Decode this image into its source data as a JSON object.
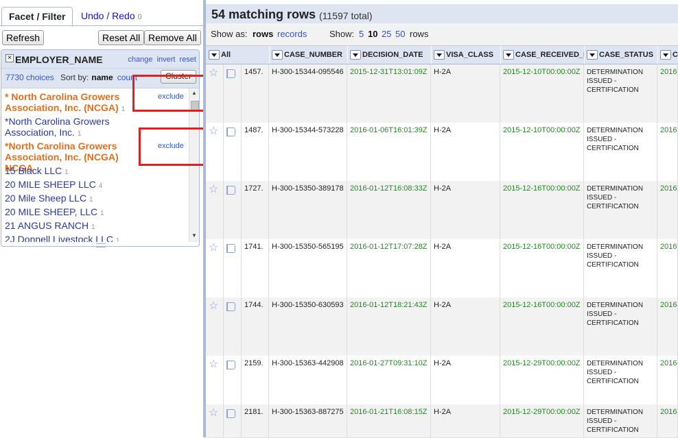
{
  "left": {
    "tabs": {
      "facet_filter": "Facet / Filter",
      "undo_redo": "Undo / Redo",
      "undo_count": "0"
    },
    "buttons": {
      "refresh": "Refresh",
      "reset_all": "Reset All",
      "remove_all": "Remove All"
    },
    "facet": {
      "title": "EMPLOYER_NAME",
      "links": {
        "change": "change",
        "invert": "invert",
        "reset": "reset"
      },
      "choices_count": "7730 choices",
      "sort_by": "Sort by:",
      "sort_name": "name",
      "sort_count": "count",
      "cluster": "Cluster",
      "items": [
        {
          "label": "* North Carolina Growers Association, Inc. (NCGA)",
          "count": "1",
          "exclude": "exclude"
        },
        {
          "label": "*North Carolina Growers Association, Inc.",
          "count": "1"
        },
        {
          "label": "*North Carolina Growers Association, Inc. (NCGA) NCGA",
          "count": "",
          "exclude": "exclude"
        },
        {
          "label": "15 Black LLC",
          "count": "1"
        },
        {
          "label": "20 MILE SHEEP LLC",
          "count": "4"
        },
        {
          "label": "20 Mile Sheep LLC",
          "count": "1"
        },
        {
          "label": "20 MILE SHEEP, LLC",
          "count": "1"
        },
        {
          "label": "21 ANGUS RANCH",
          "count": "1"
        },
        {
          "label": "2J Donnell Livestock LLC",
          "count": "1"
        }
      ]
    }
  },
  "right": {
    "title": "54 matching rows",
    "total": "(11597 total)",
    "show_as": "Show as:",
    "rows": "rows",
    "records": "records",
    "show": "Show:",
    "page_sizes": [
      "5",
      "10",
      "25",
      "50"
    ],
    "rows_suffix": "rows",
    "columns": [
      "All",
      "CASE_NUMBER",
      "DECISION_DATE",
      "VISA_CLASS",
      "CASE_RECEIVED_D",
      "CASE_STATUS",
      "C"
    ],
    "rows_data": [
      {
        "idx": "1457.",
        "case": "H-300-15344-095546",
        "decision": "2015-12-31T13:01:09Z",
        "visa": "H-2A",
        "received": "2015-12-10T00:00:00Z",
        "status": "DETERMINATION ISSUED - CERTIFICATION",
        "next": "2016"
      },
      {
        "idx": "1487.",
        "case": "H-300-15344-573228",
        "decision": "2016-01-06T16:01:39Z",
        "visa": "H-2A",
        "received": "2015-12-10T00:00:00Z",
        "status": "DETERMINATION ISSUED - CERTIFICATION",
        "next": "2016"
      },
      {
        "idx": "1727.",
        "case": "H-300-15350-389178",
        "decision": "2016-01-12T16:08:33Z",
        "visa": "H-2A",
        "received": "2015-12-16T00:00:00Z",
        "status": "DETERMINATION ISSUED - CERTIFICATION",
        "next": "2016"
      },
      {
        "idx": "1741.",
        "case": "H-300-15350-565195",
        "decision": "2016-01-12T17:07:28Z",
        "visa": "H-2A",
        "received": "2015-12-16T00:00:00Z",
        "status": "DETERMINATION ISSUED - CERTIFICATION",
        "next": "2016"
      },
      {
        "idx": "1744.",
        "case": "H-300-15350-630593",
        "decision": "2016-01-12T18:21:43Z",
        "visa": "H-2A",
        "received": "2015-12-16T00:00:00Z",
        "status": "DETERMINATION ISSUED - CERTIFICATION",
        "next": "2016"
      },
      {
        "idx": "2159.",
        "case": "H-300-15363-442908",
        "decision": "2016-01-27T09:31:10Z",
        "visa": "H-2A",
        "received": "2015-12-29T00:00:00Z",
        "status": "DETERMINATION ISSUED - CERTIFICATION",
        "next": "2016"
      },
      {
        "idx": "2181.",
        "case": "H-300-15363-887275",
        "decision": "2016-01-21T16:08:15Z",
        "visa": "H-2A",
        "received": "2015-12-29T00:00:00Z",
        "status": "DETERMINATION ISSUED - CERTIFICATION",
        "next": "2016"
      }
    ]
  }
}
